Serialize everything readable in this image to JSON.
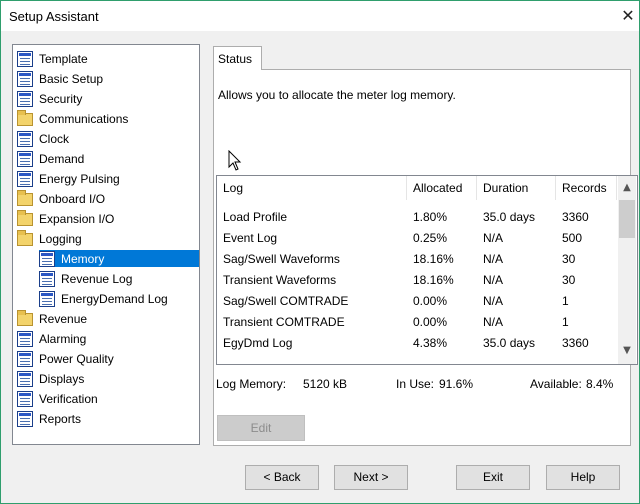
{
  "window": {
    "title": "Setup Assistant",
    "close_glyph": "✕"
  },
  "tree": {
    "items": [
      {
        "label": "Template",
        "icon": "doc",
        "indent": 0,
        "selected": false
      },
      {
        "label": "Basic Setup",
        "icon": "doc",
        "indent": 0,
        "selected": false
      },
      {
        "label": "Security",
        "icon": "doc",
        "indent": 0,
        "selected": false
      },
      {
        "label": "Communications",
        "icon": "folder",
        "indent": 0,
        "selected": false
      },
      {
        "label": "Clock",
        "icon": "doc",
        "indent": 0,
        "selected": false
      },
      {
        "label": "Demand",
        "icon": "doc",
        "indent": 0,
        "selected": false
      },
      {
        "label": "Energy Pulsing",
        "icon": "doc",
        "indent": 0,
        "selected": false
      },
      {
        "label": "Onboard I/O",
        "icon": "folder",
        "indent": 0,
        "selected": false
      },
      {
        "label": "Expansion I/O",
        "icon": "folder",
        "indent": 0,
        "selected": false
      },
      {
        "label": "Logging",
        "icon": "folder",
        "indent": 0,
        "selected": false
      },
      {
        "label": "Memory",
        "icon": "doc",
        "indent": 1,
        "selected": true
      },
      {
        "label": "Revenue Log",
        "icon": "doc",
        "indent": 1,
        "selected": false
      },
      {
        "label": "EnergyDemand Log",
        "icon": "doc",
        "indent": 1,
        "selected": false
      },
      {
        "label": "Revenue",
        "icon": "folder",
        "indent": 0,
        "selected": false
      },
      {
        "label": "Alarming",
        "icon": "doc",
        "indent": 0,
        "selected": false
      },
      {
        "label": "Power Quality",
        "icon": "doc",
        "indent": 0,
        "selected": false
      },
      {
        "label": "Displays",
        "icon": "doc",
        "indent": 0,
        "selected": false
      },
      {
        "label": "Verification",
        "icon": "doc",
        "indent": 0,
        "selected": false
      },
      {
        "label": "Reports",
        "icon": "doc",
        "indent": 0,
        "selected": false
      }
    ]
  },
  "tab": {
    "label": "Status"
  },
  "description": "Allows you to allocate the meter log memory.",
  "log_table": {
    "columns": [
      "Log",
      "Allocated",
      "Duration",
      "Records"
    ],
    "rows": [
      [
        "Load Profile",
        "1.80%",
        "35.0 days",
        "3360"
      ],
      [
        "Event Log",
        "0.25%",
        "N/A",
        "500"
      ],
      [
        "Sag/Swell Waveforms",
        "18.16%",
        "N/A",
        "30"
      ],
      [
        "Transient Waveforms",
        "18.16%",
        "N/A",
        "30"
      ],
      [
        "Sag/Swell COMTRADE",
        "0.00%",
        "N/A",
        "1"
      ],
      [
        "Transient COMTRADE",
        "0.00%",
        "N/A",
        "1"
      ],
      [
        "EgyDmd Log",
        "4.38%",
        "35.0 days",
        "3360"
      ]
    ],
    "scroll_up_glyph": "▲",
    "scroll_down_glyph": "▼"
  },
  "memory": {
    "log_memory_label": "Log Memory:",
    "log_memory_value": "5120 kB",
    "in_use_label": "In Use:",
    "in_use_value": "91.6%",
    "available_label": "Available:",
    "available_value": "8.4%"
  },
  "edit_button": {
    "label": "Edit",
    "enabled": false
  },
  "footer": {
    "back_label": "< Back",
    "next_label": "Next >",
    "exit_label": "Exit",
    "help_label": "Help"
  }
}
